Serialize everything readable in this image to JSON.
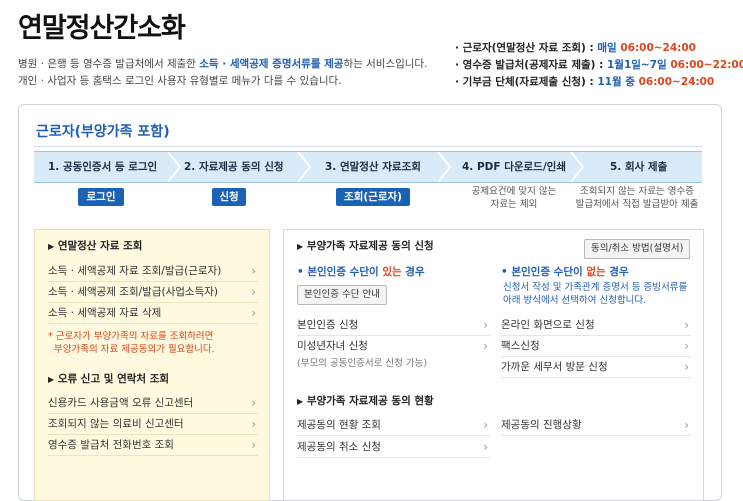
{
  "header": {
    "title": "연말정산간소화",
    "desc_line1_pre": "병원 · 은행 등 영수증 발급처에서 제출한 ",
    "desc_line1_bold": "소득 · 세액공제 증명서류를 제공",
    "desc_line1_post": "하는 서비스입니다.",
    "desc_line2": "개인 · 사업자 등 홈택스 로그인 사용자 유형별로 메뉴가 다를 수 있습니다."
  },
  "schedule": [
    {
      "bullet": "·",
      "label": "근로자(연말정산 자료 조회) : ",
      "days": "매일 ",
      "time": "06:00~24:00"
    },
    {
      "bullet": "·",
      "label": "영수증 발급처(공제자료 제출) : ",
      "days": "1월1일~7일 ",
      "time": "06:00~22:00"
    },
    {
      "bullet": "·",
      "label": "기부금 단체(자료제출 신청) : ",
      "days": "11월 중 ",
      "time": "06:00~24:00"
    }
  ],
  "card": {
    "title": "근로자(부양가족 포함)",
    "steps": [
      {
        "label": "1. 공동인증서 등 로그인",
        "button": "로그인"
      },
      {
        "label": "2. 자료제공 동의 신청",
        "button": "신청"
      },
      {
        "label": "3. 연말정산 자료조회",
        "button": "조회(근로자)"
      },
      {
        "label": "4. PDF 다운로드/인쇄",
        "note1": "공제요건에 맞지 않는",
        "note2": "자료는 제외"
      },
      {
        "label": "5. 회사 제출",
        "note1": "조회되지 않는 자료는 영수증",
        "note2": "발급처에서 직접 발급받아 제출"
      }
    ]
  },
  "left": {
    "section1_title": "연말정산 자료 조회",
    "section1_items": [
      "소득 · 세액공제 자료 조회/발급(근로자)",
      "소득 · 세액공제 조회/발급(사업소득자)",
      "소득 · 세액공제 자료 삭제"
    ],
    "note_line1": "* 근로자가 부양가족의 자료를 조회하려면",
    "note_line2": "부양가족의 자료 제공동의가 필요합니다.",
    "section2_title": "오류 신고 및 연락처 조회",
    "section2_items": [
      "신용카드 사용금액 오류 신고센터",
      "조회되지 않는 의료비 신고센터",
      "영수증 발급처 전화번호 조회"
    ]
  },
  "right": {
    "section1_title": "부양가족 자료제공 동의 신청",
    "method_button": "동의/취소 방법(설명서)",
    "has_auth_pre": "• 본인인증 수단이 ",
    "has_auth_red": "있는",
    "has_auth_post": " 경우",
    "auth_guide_button": "본인인증 수단 안내",
    "no_auth_pre": "• 본인인증 수단이 ",
    "no_auth_red": "없는",
    "no_auth_post": " 경우",
    "no_auth_note1": "신청서 작성 및 가족관계 증명서 등 증빙서류를",
    "no_auth_note2": "아래 방식에서 선택하여 신청합니다.",
    "left_items": [
      "본인인증 신청",
      "미성년자녀 신청"
    ],
    "minor_note": "(부모의 공동인증서로 신청 가능)",
    "right_items": [
      "온라인 화면으로 신청",
      "팩스신청",
      "가까운 세무서 방문 신청"
    ],
    "section2_title": "부양가족 자료제공 동의 현황",
    "status_left": [
      "제공동의 현황 조회",
      "제공동의 취소 신청"
    ],
    "status_right": [
      "제공동의 진행상황"
    ]
  },
  "colors": {
    "accent_blue": "#1f5fb5",
    "button_blue": "#1a63b4",
    "highlight_red": "#e2441b",
    "step_bar": "#d9ebf8",
    "left_panel_bg": "#fff9df"
  },
  "icons": {
    "bullet": "▶",
    "arrow": "›"
  }
}
